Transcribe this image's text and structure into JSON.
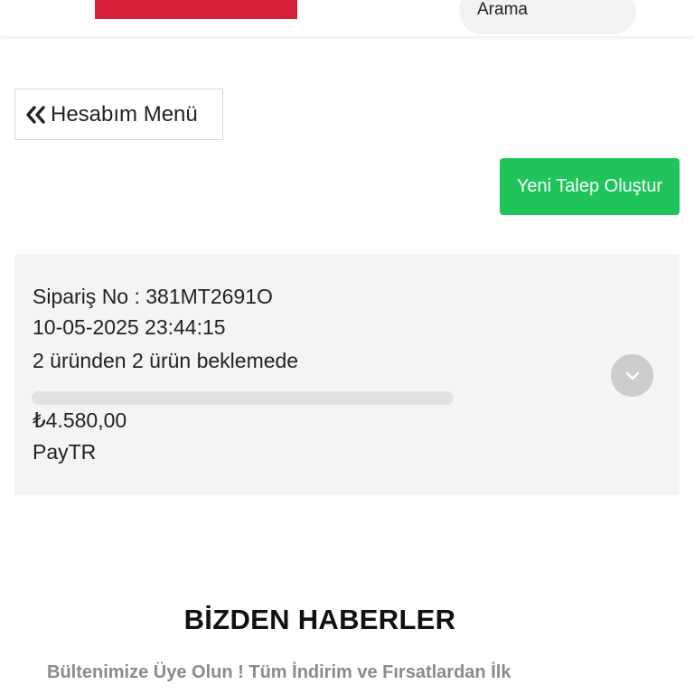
{
  "header": {
    "search_label": "Arama",
    "brand_color": "#d61f3b"
  },
  "account": {
    "back_label": "Hesabım Menü",
    "back_icon": "double-chevron-left-icon"
  },
  "actions": {
    "new_request_label": "Yeni Talep Oluştur",
    "new_request_color": "#1fc45a"
  },
  "order": {
    "order_no_text": "Sipariş No : 381MT2691O",
    "datetime": "10-05-2025 23:44:15",
    "status_text": "2 üründen 2 ürün beklemede",
    "progress": 0,
    "total": "₺4.580,00",
    "payment_method": "PayTR",
    "expand_icon": "chevron-down-icon"
  },
  "newsletter": {
    "title": "BİZDEN HABERLER",
    "subtitle": "Bültenimize Üye Olun ! Tüm İndirim ve Fırsatlardan İlk"
  }
}
